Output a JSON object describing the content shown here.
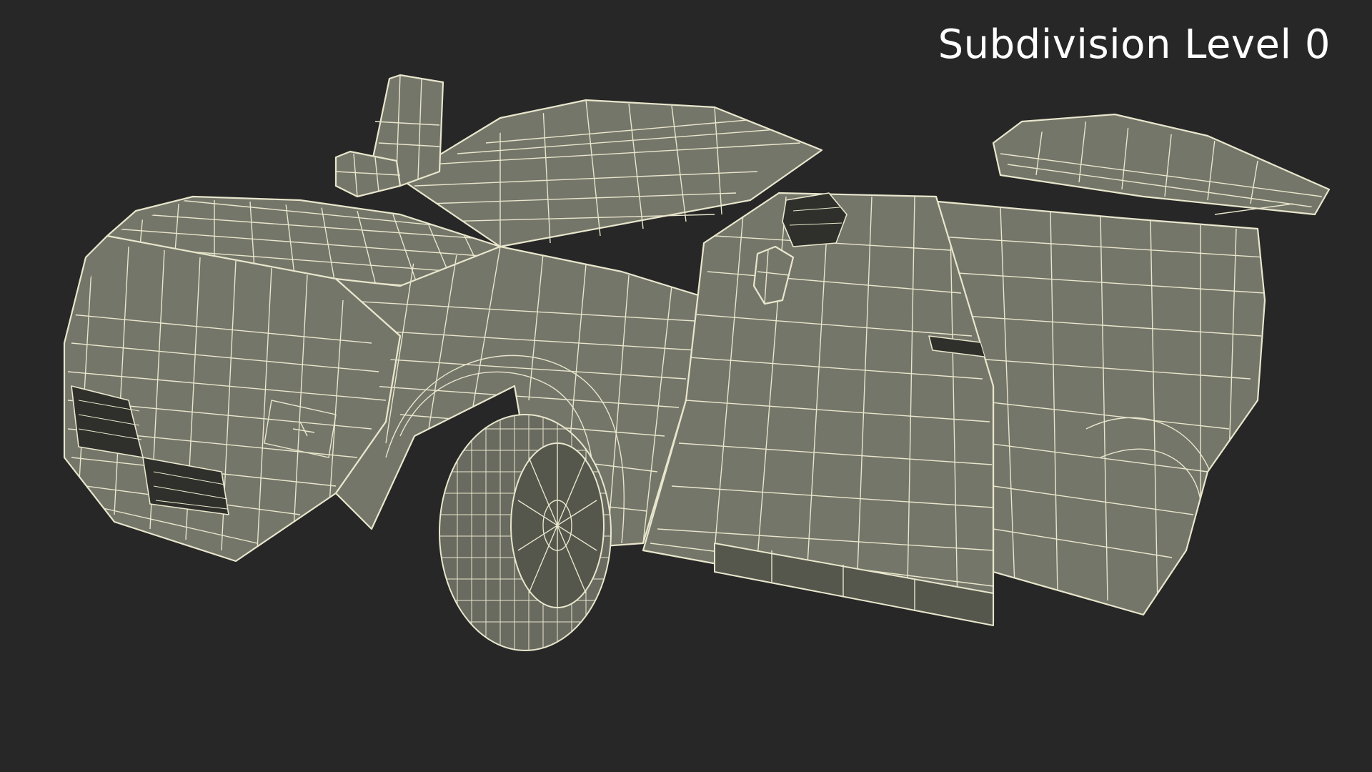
{
  "overlay": {
    "label": "Subdivision Level 0"
  },
  "scene": {
    "background_color": "#272727",
    "mesh_fill_color": "#75766a",
    "wire_color": "#e8e6cc"
  },
  "icons": {
    "car_model": "wireframe-suv-icon"
  }
}
